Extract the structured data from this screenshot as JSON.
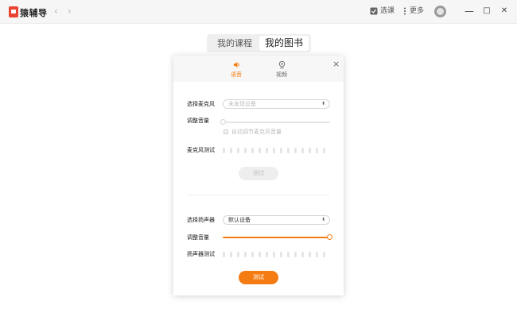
{
  "app": {
    "name": "猿辅导"
  },
  "toolbar": {
    "back": "‹",
    "forward": "›",
    "select_course": "选课",
    "more": "更多"
  },
  "window": {
    "minimize": "—",
    "maximize": "□",
    "close": "✕"
  },
  "tabs": [
    {
      "label": "我的课程",
      "active": false
    },
    {
      "label": "我的图书",
      "active": true
    }
  ],
  "dialog": {
    "close": "×",
    "tabs": [
      {
        "label": "语音",
        "icon": "speaker-icon",
        "active": true
      },
      {
        "label": "视频",
        "icon": "camera-icon",
        "active": false
      }
    ],
    "microphone": {
      "select_label": "选择麦克风",
      "device_placeholder": "未发现设备",
      "volume_label": "调整音量",
      "volume_level": 0,
      "auto_adjust_label": "自动调节麦克风音量",
      "test_label": "麦克风测试",
      "test_button": "测试"
    },
    "speaker": {
      "select_label": "选择扬声器",
      "device_value": "默认设备",
      "volume_label": "调整音量",
      "volume_level": 1.0,
      "test_label": "扬声器测试",
      "test_button": "测试"
    }
  },
  "colors": {
    "accent": "#f57c13",
    "disabled_button": "#eeeeee",
    "track_empty": "#e6e6e6"
  }
}
